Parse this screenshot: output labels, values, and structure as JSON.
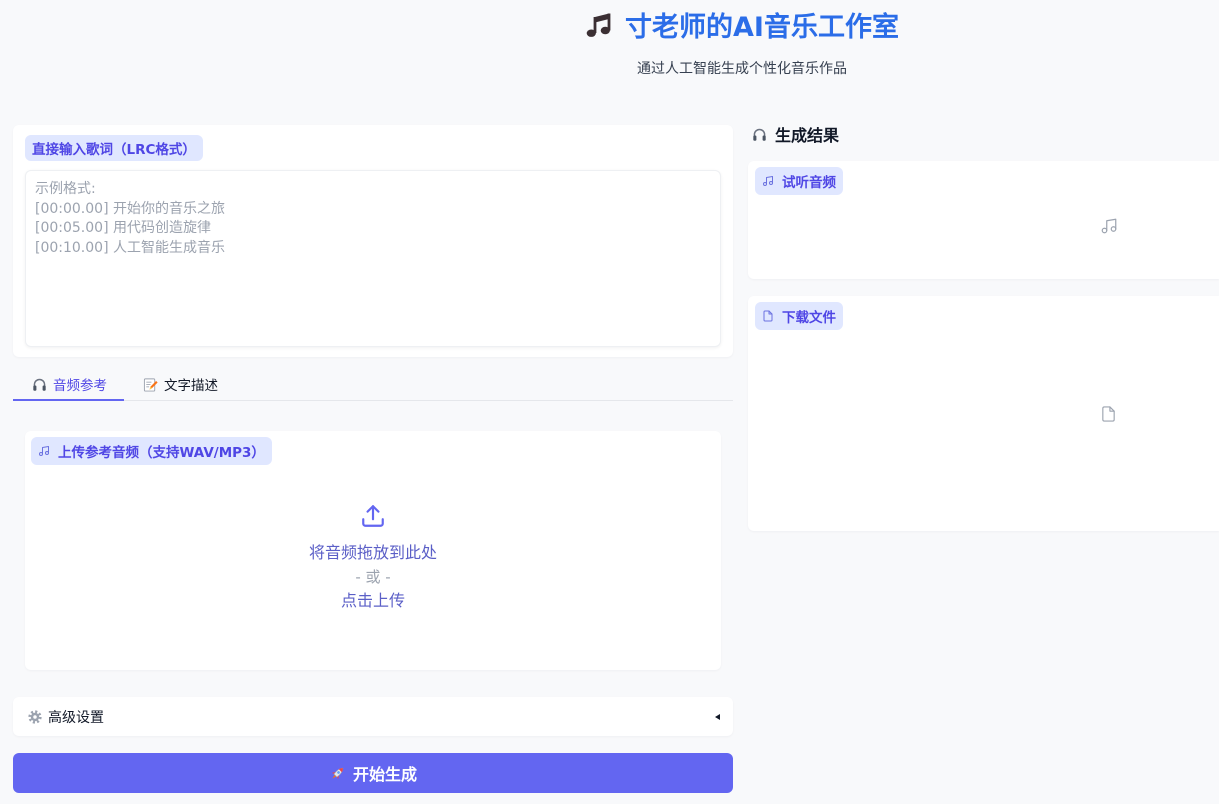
{
  "header": {
    "icon": "music-note-icon",
    "title": "寸老师的AI音乐工作室",
    "subtitle": "通过人工智能生成个性化音乐作品"
  },
  "lyrics": {
    "label": "直接输入歌词（LRC格式）",
    "value": "",
    "placeholder": "示例格式:\n[00:00.00] 开始你的音乐之旅\n[00:05.00] 用代码创造旋律\n[00:10.00] 人工智能生成音乐"
  },
  "tabs": [
    {
      "label": "音频参考",
      "icon": "headphones-icon",
      "selected": true
    },
    {
      "label": "文字描述",
      "icon": "memo-icon",
      "selected": false
    }
  ],
  "upload": {
    "label": "上传参考音频（支持WAV/MP3）",
    "icon": "music-note-icon",
    "drop_text": "将音频拖放到此处",
    "or_text": "- 或 -",
    "click_text": "点击上传",
    "upload_icon": "upload-icon"
  },
  "advanced": {
    "label": "高级设置",
    "icon": "gear-icon",
    "collapsed": true
  },
  "generate_button": {
    "label": "开始生成",
    "icon": "rocket-icon"
  },
  "results": {
    "title": "生成结果",
    "icon": "headphones-icon",
    "audio": {
      "label": "试听音频",
      "icon": "music-note-icon"
    },
    "file": {
      "label": "下载文件",
      "icon": "file-icon"
    }
  },
  "colors": {
    "accent": "#6366f1",
    "accent_text": "#4f46e5",
    "badge_bg": "#e0e7ff",
    "title_blue": "#2b6de8",
    "page_bg": "#f8f9fb"
  }
}
